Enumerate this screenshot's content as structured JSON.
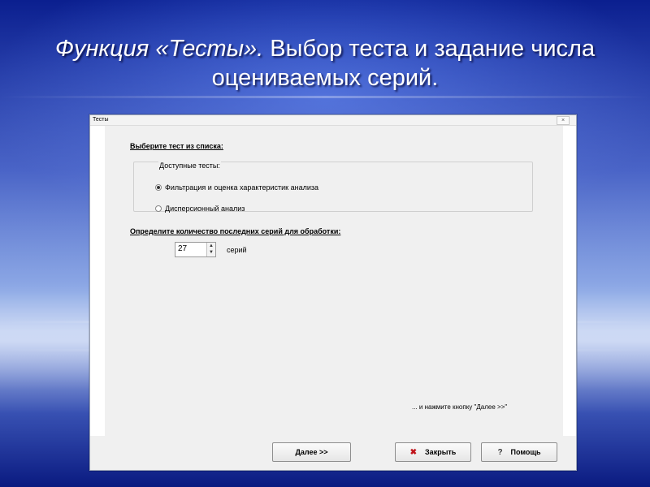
{
  "slide": {
    "title_italic": "Функция «Тесты».",
    "title_rest": " Выбор теста и задание числа оцениваемых серий."
  },
  "window": {
    "title": "Тесты",
    "close_label": "×"
  },
  "test_section": {
    "label": "Выберите тест из списка:",
    "group_label": "Доступные тесты:",
    "options": [
      {
        "label": "Фильтрация и оценка характеристик анализа",
        "selected": true
      },
      {
        "label": "Дисперсионный анализ",
        "selected": false
      }
    ]
  },
  "series_section": {
    "label": "Определите количество последних серий для обработки:",
    "value": "27",
    "units": "серий",
    "up_arrow": "▲",
    "down_arrow": "▼"
  },
  "hint": "... и нажмите кнопку \"Далее >>\"",
  "buttons": {
    "next_label": "Далее  >>",
    "close_label": "Закрыть",
    "close_icon": "✖",
    "help_label": "Помощь",
    "help_icon": "?"
  }
}
